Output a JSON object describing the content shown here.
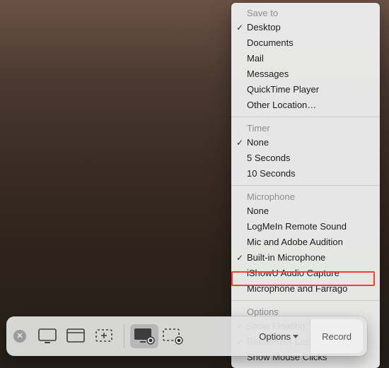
{
  "menu": {
    "sections": {
      "save_to": {
        "header": "Save to",
        "items": [
          {
            "label": "Desktop",
            "checked": true
          },
          {
            "label": "Documents",
            "checked": false
          },
          {
            "label": "Mail",
            "checked": false
          },
          {
            "label": "Messages",
            "checked": false
          },
          {
            "label": "QuickTime Player",
            "checked": false
          },
          {
            "label": "Other Location…",
            "checked": false
          }
        ]
      },
      "timer": {
        "header": "Timer",
        "items": [
          {
            "label": "None",
            "checked": true
          },
          {
            "label": "5 Seconds",
            "checked": false
          },
          {
            "label": "10 Seconds",
            "checked": false
          }
        ]
      },
      "microphone": {
        "header": "Microphone",
        "items": [
          {
            "label": "None",
            "checked": false
          },
          {
            "label": "LogMeIn Remote Sound",
            "checked": false
          },
          {
            "label": "Mic and Adobe Audition",
            "checked": false
          },
          {
            "label": "Built-in Microphone",
            "checked": true
          },
          {
            "label": "iShowU Audio Capture",
            "checked": false
          },
          {
            "label": "Microphone and Farrago",
            "checked": false
          }
        ]
      },
      "options": {
        "header": "Options",
        "items": [
          {
            "label": "Show Floating Thumbnail",
            "checked": true,
            "highlighted": true
          },
          {
            "label": "Remember Last Selection",
            "checked": true
          },
          {
            "label": "Show Mouse Clicks",
            "checked": false
          }
        ]
      }
    }
  },
  "toolbar": {
    "options_label": "Options",
    "record_label": "Record",
    "capture_buttons": [
      {
        "id": "capture-entire-screen",
        "icon": "screen-icon"
      },
      {
        "id": "capture-selected-window",
        "icon": "window-icon"
      },
      {
        "id": "capture-selected-portion",
        "icon": "selection-icon"
      }
    ],
    "record_buttons": [
      {
        "id": "record-entire-screen",
        "icon": "screen-record-icon",
        "selected": true
      },
      {
        "id": "record-selected-portion",
        "icon": "selection-record-icon"
      }
    ]
  },
  "accent": "#ff3b30"
}
